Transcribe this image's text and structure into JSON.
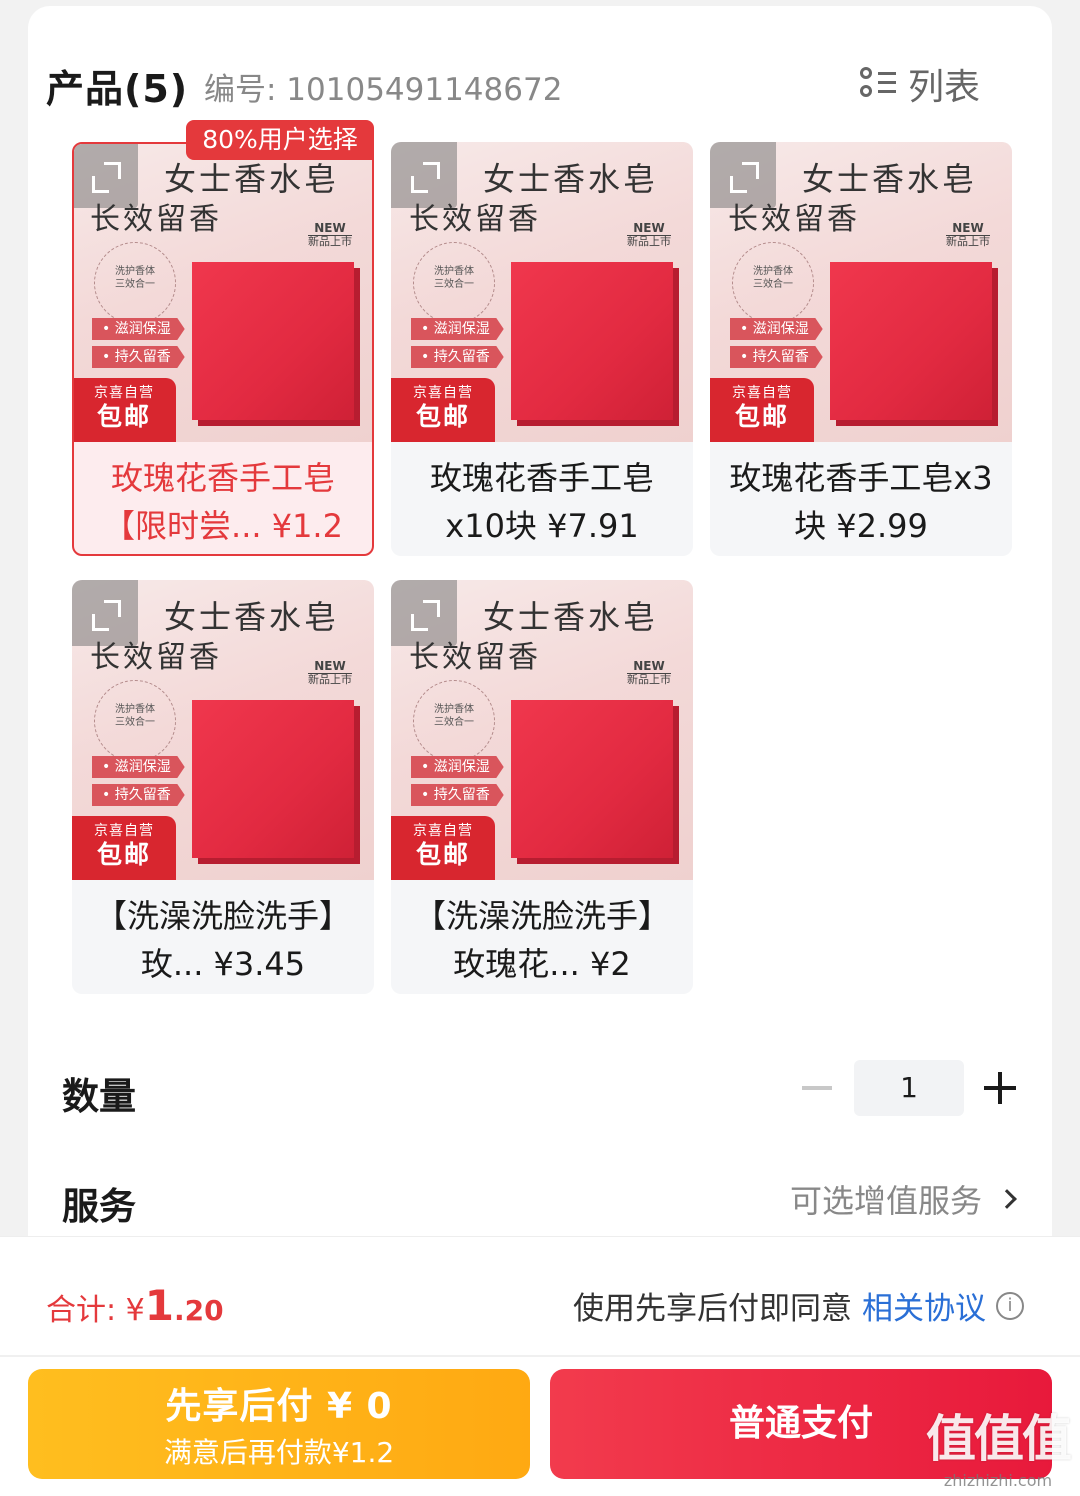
{
  "header": {
    "title": "产品(5)",
    "code_label": "编号: 10105491148672",
    "view_toggle_label": "列表"
  },
  "product_image": {
    "title_line1": "女士香水皂",
    "title_line2": "长效留香",
    "new_tag": "NEW",
    "new_tag_sub": "新品上市",
    "circle_line1": "洗护香体",
    "circle_line2": "三效合一",
    "pill1": "滋润保湿",
    "pill2": "持久留香",
    "badge_line1": "京喜自营",
    "badge_line2": "包邮"
  },
  "selection_tag": "80%用户选择",
  "products": [
    {
      "line1": "玫瑰花香手工皂",
      "line2": "【限时尝...  ¥1.2",
      "selected": true
    },
    {
      "line1": "玫瑰花香手工皂",
      "line2": "x10块  ¥7.91",
      "selected": false
    },
    {
      "line1": "玫瑰花香手工皂x3",
      "line2": "块  ¥2.99",
      "selected": false
    },
    {
      "line1": "【洗澡洗脸洗手】",
      "line2": "玫...  ¥3.45",
      "selected": false
    },
    {
      "line1": "【洗澡洗脸洗手】",
      "line2": "玫瑰花...  ¥2",
      "selected": false
    }
  ],
  "quantity": {
    "label": "数量",
    "value": "1"
  },
  "service": {
    "label": "服务",
    "value": "可选增值服务"
  },
  "footer": {
    "total_prefix": "合计: ¥",
    "total_int": "1",
    "total_dec": ".20",
    "agree_text": "使用先享后付即同意",
    "agree_link": "相关协议",
    "info_icon": "i",
    "bnpl_main": "先享后付 ¥ 0",
    "bnpl_sub": "满意后再付款¥1.2",
    "pay_label": "普通支付"
  },
  "watermark": {
    "main": "值值值",
    "sub": "zhizhizhi.com"
  },
  "colors": {
    "accent": "#e4393c",
    "bnpl": "#ffb318",
    "link": "#2a6fd6"
  }
}
